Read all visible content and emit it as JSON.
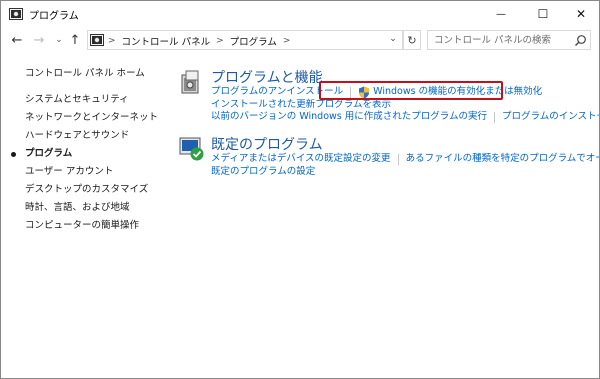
{
  "window": {
    "title": "プログラム",
    "minimize_glyph": "—",
    "maximize_glyph": "☐",
    "close_glyph": "✕"
  },
  "nav": {
    "back_glyph": "←",
    "forward_glyph": "→",
    "recent_glyph": "⌄",
    "up_glyph": "↑",
    "dropdown_glyph": "⌄",
    "refresh_glyph": "↻"
  },
  "address": {
    "separator": ">",
    "segments": [
      "コントロール パネル",
      "プログラム"
    ]
  },
  "search": {
    "placeholder": "コントロール パネルの検索"
  },
  "sidebar": {
    "home": "コントロール パネル ホーム",
    "items": [
      {
        "label": "システムとセキュリティ"
      },
      {
        "label": "ネットワークとインターネット"
      },
      {
        "label": "ハードウェアとサウンド"
      },
      {
        "label": "プログラム"
      },
      {
        "label": "ユーザー アカウント"
      },
      {
        "label": "デスクトップのカスタマイズ"
      },
      {
        "label": "時計、言語、および地域"
      },
      {
        "label": "コンピューターの簡単操作"
      }
    ]
  },
  "programs_section": {
    "title": "プログラムと機能",
    "links": {
      "uninstall": "プログラムのアンインストール",
      "windows_features": "Windows の機能の有効化または無効化",
      "installed_updates": "インストールされた更新プログラムを表示",
      "compat": "以前のバージョンの Windows 用に作成されたプログラムの実行",
      "how_to_install": "プログラムのインストール方法"
    }
  },
  "defaults_section": {
    "title": "既定のプログラム",
    "links": {
      "media_defaults": "メディアまたはデバイスの既定設定の変更",
      "file_types": "あるファイルの種類を特定のプログラムでオープン",
      "set_defaults": "既定のプログラムの設定"
    }
  },
  "colors": {
    "link": "#0066cc",
    "heading": "#1e5aa8",
    "highlight": "#c0111f"
  }
}
